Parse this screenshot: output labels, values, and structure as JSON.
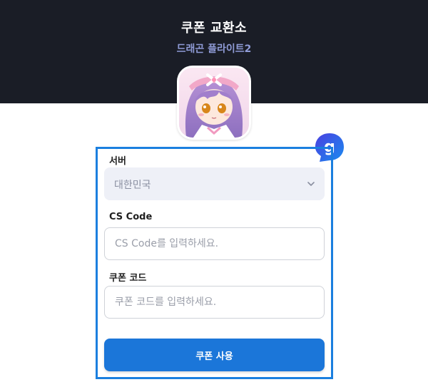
{
  "header": {
    "title": "쿠폰 교환소",
    "subtitle": "드래곤 플라이트2"
  },
  "form": {
    "server": {
      "label": "서버",
      "selected": "대한민국"
    },
    "cs_code": {
      "label": "CS Code",
      "placeholder": "CS Code를 입력하세요."
    },
    "coupon_code": {
      "label": "쿠폰 코드",
      "placeholder": "쿠폰 코드를 입력하세요."
    },
    "submit_label": "쿠폰 사용"
  },
  "badge": {
    "letter": "g"
  },
  "colors": {
    "header_bg": "#1a1d26",
    "subtitle": "#8f9bd6",
    "accent_border": "#1b7fdf",
    "button": "#1b76d9",
    "select_bg": "#eef0f7",
    "badge_gradient": [
      "#4a3fe0",
      "#1a8cf0"
    ]
  }
}
